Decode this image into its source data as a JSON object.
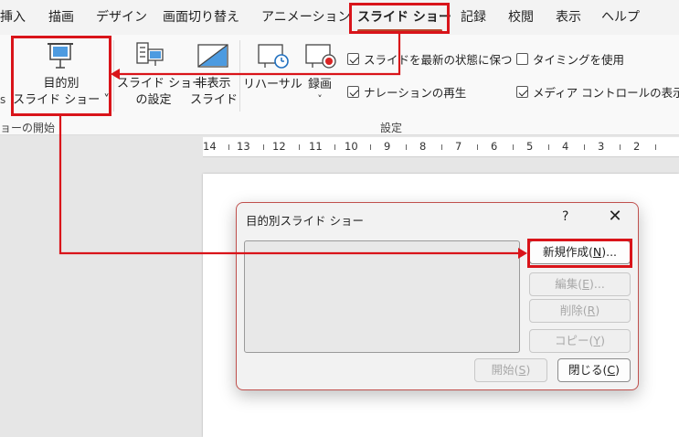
{
  "tabs": [
    {
      "label": "挿入"
    },
    {
      "label": "描画"
    },
    {
      "label": "デザイン"
    },
    {
      "label": "画面切り替え"
    },
    {
      "label": "アニメーション"
    },
    {
      "label": "スライド ショー"
    },
    {
      "label": "記録"
    },
    {
      "label": "校閲"
    },
    {
      "label": "表示"
    },
    {
      "label": "ヘルプ"
    }
  ],
  "ribbon": {
    "custom_show_line1": "目的別",
    "custom_show_line2": "スライド ショー ˅",
    "setup_line1": "スライド ショー",
    "setup_line2": "の設定",
    "hide_line1": "非表示",
    "hide_line2": "スライド",
    "rehearse": "リハーサル",
    "record": "録画",
    "record_chevron": "˅",
    "cb_keep_fresh": "スライドを最新の状態に保つ",
    "cb_use_timings": "タイミングを使用",
    "cb_play_narrations": "ナレーションの再生",
    "cb_show_media_controls": "メディア コントロールの表示",
    "group_start": "ョーの開始",
    "group_setup": "設定",
    "left_edge_glyph": "s"
  },
  "checkbox_states": {
    "keep_fresh": true,
    "use_timings": false,
    "play_narrations": true,
    "show_media_controls": true
  },
  "ruler": {
    "numbers": [
      "14",
      "13",
      "12",
      "11",
      "10",
      "9",
      "8",
      "7",
      "6",
      "5",
      "4",
      "3",
      "2"
    ]
  },
  "dialog": {
    "title": "目的別スライド ショー",
    "help": "?",
    "close": "✕",
    "new_text": "新規作成(",
    "new_key": "N",
    "new_tail": ")...",
    "edit_text": "編集(",
    "edit_key": "E",
    "edit_tail": ")...",
    "delete_text": "削除(",
    "delete_key": "R",
    "delete_tail": ")",
    "copy_text": "コピー(",
    "copy_key": "Y",
    "copy_tail": ")",
    "start_text": "開始(",
    "start_key": "S",
    "start_tail": ")",
    "close_btn_text": "閉じる(",
    "close_btn_key": "C",
    "close_btn_tail": ")"
  },
  "colors": {
    "highlight": "#d9141a",
    "tab_underline": "#b7472a",
    "dialog_border": "#c0504d"
  }
}
